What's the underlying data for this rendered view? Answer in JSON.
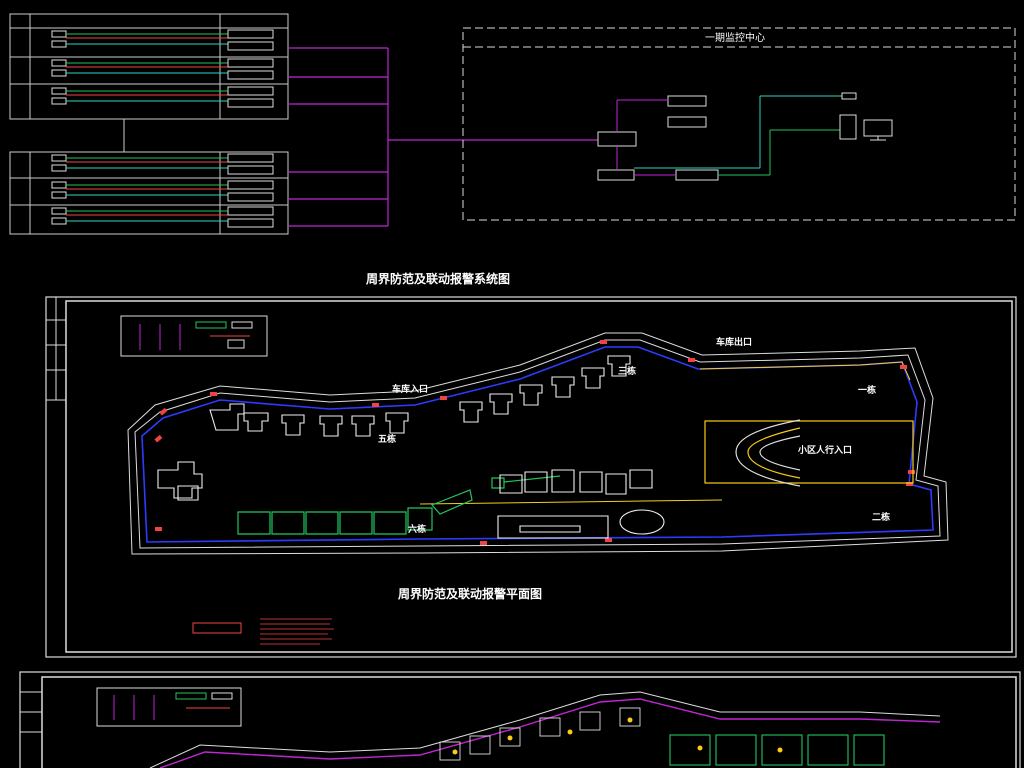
{
  "monitor_center": {
    "title": "一期监控中心"
  },
  "system_caption": "周界防范及联动报警系统图",
  "plan": {
    "title": "周界防范及联动报警平面图",
    "labels": {
      "garage_exit": "车库出口",
      "garage_entry": "车库入口",
      "building_1": "一栋",
      "building_2": "二栋",
      "building_3": "三栋",
      "building_5": "五栋",
      "building_6": "六栋",
      "pedestrian_entry": "小区人行入口"
    }
  },
  "colors": {
    "background": "#000000",
    "frame": "#ffffff",
    "magenta": "#d946ef",
    "green": "#22c55e",
    "red": "#ef4444",
    "blue": "#2b3cff",
    "yellow": "#facc15"
  }
}
